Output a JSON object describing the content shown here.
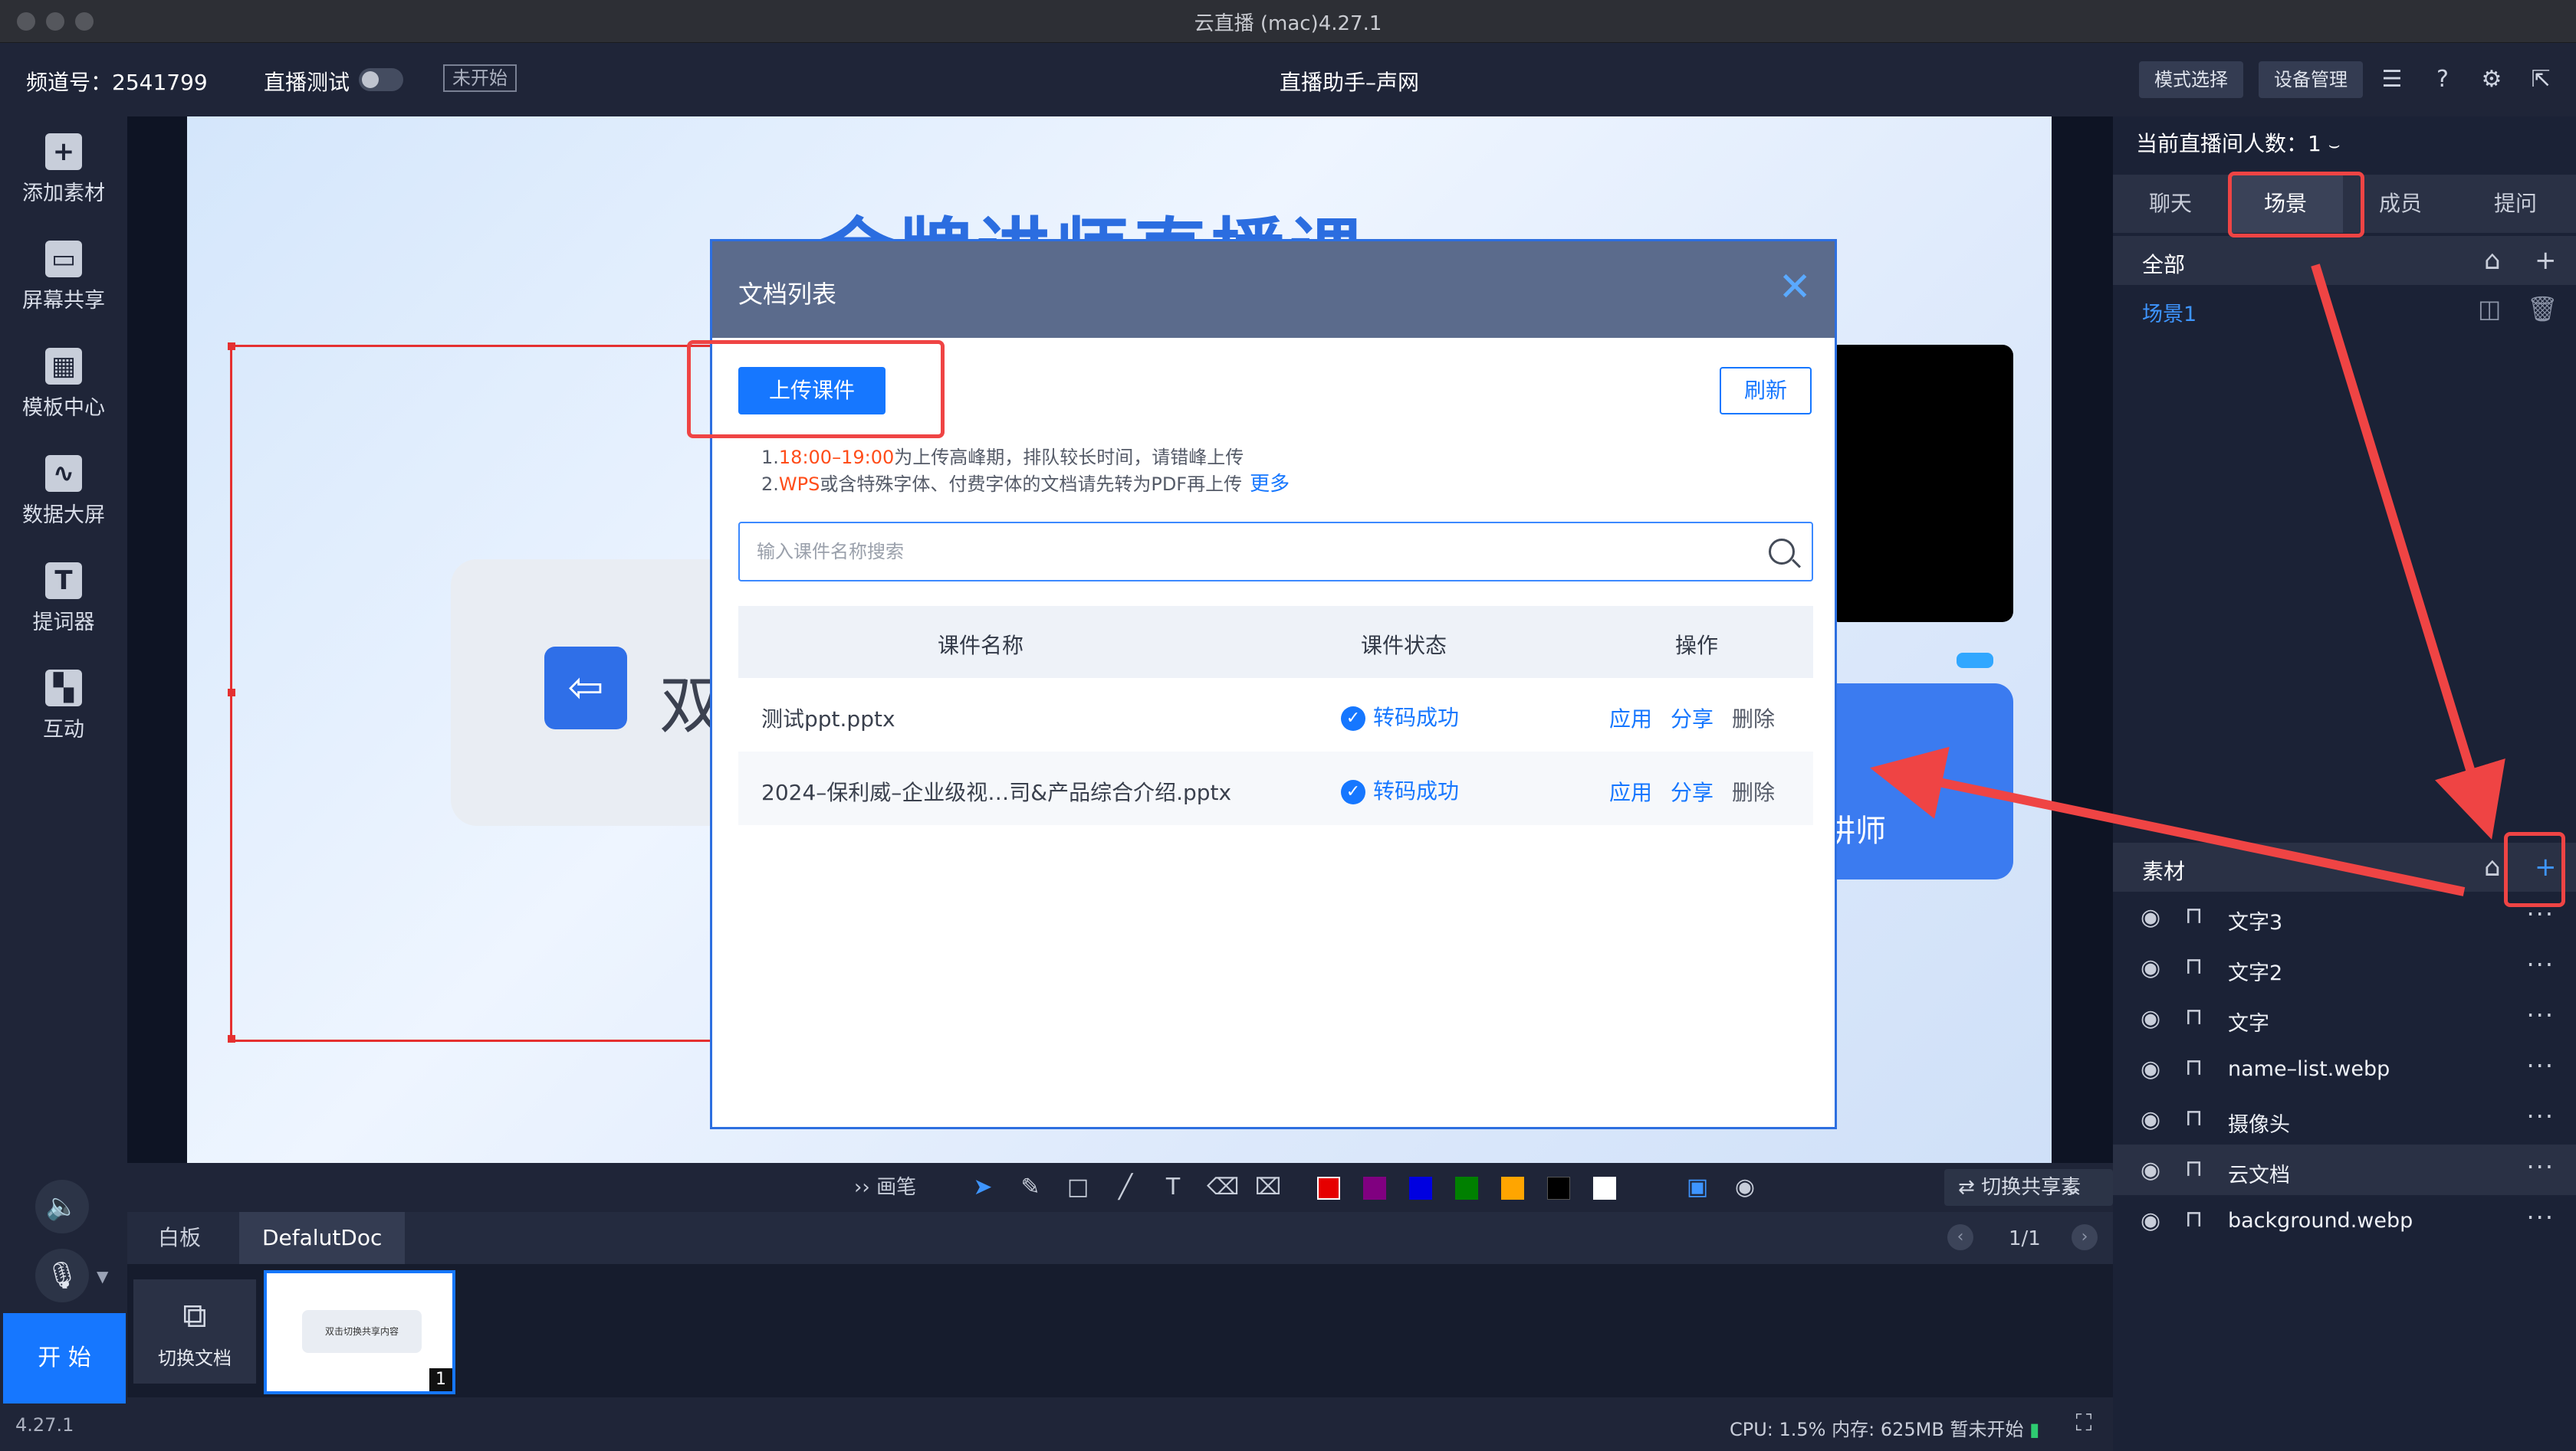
{
  "window": {
    "title": "云直播 (mac)4.27.1"
  },
  "topbar": {
    "channel": "频道号：2541799",
    "live_test_label": "直播测试",
    "status_badge": "未开始",
    "center_title": "直播助手–声网",
    "mode_select": "模式选择",
    "device_manage": "设备管理"
  },
  "sidebar": {
    "items": [
      {
        "label": "添加素材",
        "icon": "add-material-icon"
      },
      {
        "label": "屏幕共享",
        "icon": "screen-share-icon"
      },
      {
        "label": "模板中心",
        "icon": "template-icon"
      },
      {
        "label": "数据大屏",
        "icon": "data-screen-icon"
      },
      {
        "label": "提词器",
        "icon": "teleprompter-icon"
      },
      {
        "label": "互动",
        "icon": "interaction-icon"
      }
    ],
    "start_label": "开 始",
    "version": "4.27.1"
  },
  "slide": {
    "title": "金牌讲师直播课",
    "card_text": "双",
    "blue_card_text": "讲师"
  },
  "modal": {
    "title": "文档列表",
    "upload_label": "上传课件",
    "refresh_label": "刷新",
    "notice1_prefix": "1.",
    "notice1_highlight": "18:00–19:00",
    "notice1_suffix": "为上传高峰期，排队较长时间，请错峰上传",
    "notice2_prefix": "2.",
    "notice2_highlight": "WPS",
    "notice2_suffix": "或含特殊字体、付费字体的文档请先转为PDF再上传",
    "notice_more": "更多",
    "search_placeholder": "输入课件名称搜索",
    "columns": {
      "name": "课件名称",
      "status": "课件状态",
      "action": "操作"
    },
    "rows": [
      {
        "name": "测试ppt.pptx",
        "status": "转码成功",
        "apply": "应用",
        "share": "分享",
        "delete": "删除"
      },
      {
        "name": "2024–保利威–企业级视…司&产品综合介绍.pptx",
        "status": "转码成功",
        "apply": "应用",
        "share": "分享",
        "delete": "删除"
      }
    ]
  },
  "drawbar": {
    "pen_label": "画笔",
    "switch_share": "切换共享素材",
    "colors": [
      "#e60000",
      "#800080",
      "#0000e0",
      "#008000",
      "#ffa500",
      "#000000",
      "#ffffff"
    ]
  },
  "doc": {
    "tabs": [
      "白板",
      "DefalutDoc"
    ],
    "page": "1/1",
    "switch_doc": "切换文档",
    "thumb_text": "双击切换共享内容",
    "thumb_num": "1"
  },
  "statusbar": {
    "cpu": "CPU: 1.5%",
    "mem": "内存: 625MB",
    "state": "暂未开始"
  },
  "right": {
    "viewers": "当前直播间人数：1",
    "tabs": [
      "聊天",
      "场景",
      "成员",
      "提问"
    ],
    "scene_section": "全部",
    "scene": "场景1",
    "material_section": "素材",
    "materials": [
      "文字3",
      "文字2",
      "文字",
      "name–list.webp",
      "摄像头",
      "云文档",
      "background.webp"
    ]
  },
  "annotation_color": "#ef4444",
  "accent_color": "#1677ff"
}
